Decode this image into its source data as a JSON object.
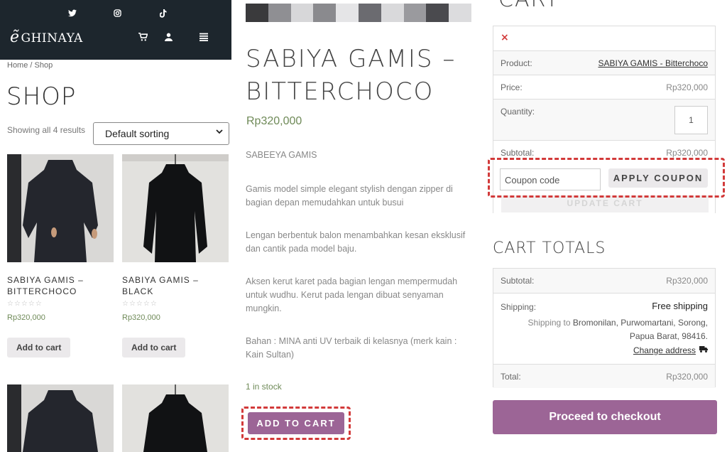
{
  "colors": {
    "nav_bg": "#1d262d",
    "accent_purple": "#9c6596",
    "price_green": "#6f8a58",
    "highlight_red": "#d23a3a"
  },
  "shop": {
    "brand": "GHINAYA",
    "social_icons": [
      "twitter-icon",
      "instagram-icon",
      "tiktok-icon"
    ],
    "nav_icons": [
      "cart-icon",
      "account-icon",
      "menu-icon"
    ],
    "breadcrumb": "Home / Shop",
    "title": "SHOP",
    "result_count": "Showing all 4 results",
    "sort_selected": "Default sorting",
    "products": [
      {
        "name": "SABIYA GAMIS – BITTERCHOCO",
        "price": "Rp320,000",
        "button": "Add to cart",
        "rating_stars": 0
      },
      {
        "name": "SABIYA GAMIS – BLACK",
        "price": "Rp320,000",
        "button": "Add to cart",
        "rating_stars": 0
      }
    ]
  },
  "product": {
    "title": "SABIYA GAMIS – BITTERCHOCO",
    "price": "Rp320,000",
    "description": [
      "SABEEYA GAMIS",
      "Gamis model simple elegant stylish dengan zipper di bagian depan memudahkan untuk busui",
      "Lengan berbentuk balon menambahkan kesan eksklusif dan cantik pada model baju.",
      "Aksen kerut karet pada bagian lengan mempermudah untuk wudhu. Kerut pada lengan dibuat senyaman mungkin.",
      "Bahan : MINA anti UV terbaik di kelasnya (merk kain : Kain Sultan)"
    ],
    "stock": "1 in stock",
    "add_to_cart": "ADD TO CART"
  },
  "cart": {
    "title": "CART",
    "remove": "×",
    "rows": {
      "product_label": "Product:",
      "product_value": "SABIYA GAMIS - Bitterchoco",
      "price_label": "Price:",
      "price_value": "Rp320,000",
      "quantity_label": "Quantity:",
      "quantity_value": "1",
      "subtotal_label": "Subtotal:",
      "subtotal_value": "Rp320,000"
    },
    "coupon_placeholder": "Coupon code",
    "apply_coupon": "APPLY COUPON",
    "update_cart": "UPDATE CART",
    "totals_title": "CART TOTALS",
    "totals": {
      "subtotal_label": "Subtotal:",
      "subtotal_value": "Rp320,000",
      "shipping_label": "Shipping:",
      "shipping_method": "Free shipping",
      "shipping_prefix": "Shipping to",
      "shipping_address": "Bromonilan, Purwomartani, Sorong, Papua Barat, 98416.",
      "change_address": "Change address",
      "total_label": "Total:",
      "total_value": "Rp320,000"
    },
    "checkout": "Proceed to checkout"
  }
}
